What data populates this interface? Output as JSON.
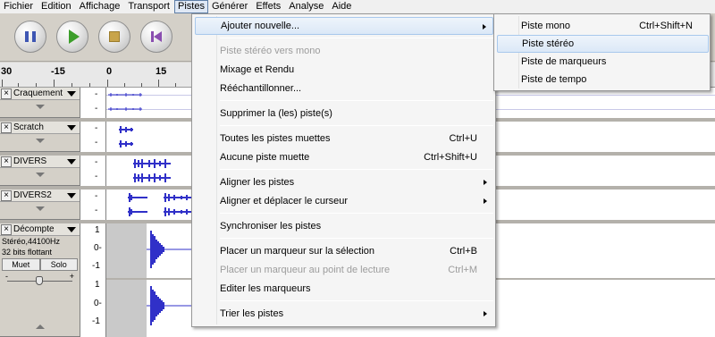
{
  "menubar": {
    "items": [
      "Fichier",
      "Edition",
      "Affichage",
      "Transport",
      "Pistes",
      "Générer",
      "Effets",
      "Analyse",
      "Aide"
    ],
    "active": "Pistes"
  },
  "transport": {
    "buttons": [
      {
        "name": "pause-button",
        "icon": "pause-icon"
      },
      {
        "name": "play-button",
        "icon": "play-icon"
      },
      {
        "name": "stop-button",
        "icon": "stop-icon"
      },
      {
        "name": "skip-start-button",
        "icon": "skip-start-icon"
      }
    ]
  },
  "ruler": {
    "labels": [
      "30",
      "-15",
      "0",
      "15"
    ]
  },
  "tracks": [
    {
      "name": "Craquement"
    },
    {
      "name": "Scratch"
    },
    {
      "name": "DIVERS"
    },
    {
      "name": "DIVERS2"
    },
    {
      "name": "Décompte",
      "info": [
        "Stéréo,44100Hz",
        "32 bits flottant"
      ],
      "mute": "Muet",
      "solo": "Solo",
      "gain_minus": "-",
      "gain_plus": "+",
      "scale_top": [
        "1",
        "0-",
        "-1"
      ],
      "scale_bottom": [
        "1",
        "0-",
        "-1"
      ]
    }
  ],
  "scale_small": [
    "-",
    "-"
  ],
  "pistes_menu": {
    "items": [
      {
        "label": "Ajouter nouvelle...",
        "shortcut": "",
        "submenu": true,
        "disabled": false,
        "hover": true
      },
      {
        "label": "Piste stéréo vers mono",
        "shortcut": "",
        "submenu": false,
        "disabled": true
      },
      {
        "label": "Mixage et Rendu",
        "shortcut": "",
        "submenu": false,
        "disabled": false
      },
      {
        "label": "Rééchantillonner...",
        "shortcut": "",
        "submenu": false,
        "disabled": false
      },
      {
        "label": "Supprimer la (les) piste(s)",
        "shortcut": "",
        "submenu": false,
        "disabled": false
      },
      {
        "label": "Toutes les pistes muettes",
        "shortcut": "Ctrl+U",
        "submenu": false,
        "disabled": false
      },
      {
        "label": "Aucune piste muette",
        "shortcut": "Ctrl+Shift+U",
        "submenu": false,
        "disabled": false
      },
      {
        "label": "Aligner les pistes",
        "shortcut": "",
        "submenu": true,
        "disabled": false
      },
      {
        "label": "Aligner et déplacer le curseur",
        "shortcut": "",
        "submenu": true,
        "disabled": false
      },
      {
        "label": "Synchroniser les pistes",
        "shortcut": "",
        "submenu": false,
        "disabled": false
      },
      {
        "label": "Placer un marqueur sur la sélection",
        "shortcut": "Ctrl+B",
        "submenu": false,
        "disabled": false
      },
      {
        "label": "Placer un marqueur au point de lecture",
        "shortcut": "Ctrl+M",
        "submenu": false,
        "disabled": true
      },
      {
        "label": "Editer les marqueurs",
        "shortcut": "",
        "submenu": false,
        "disabled": false
      },
      {
        "label": "Trier les pistes",
        "shortcut": "",
        "submenu": true,
        "disabled": false
      }
    ]
  },
  "ajouter_submenu": {
    "items": [
      {
        "label": "Piste mono",
        "shortcut": "Ctrl+Shift+N",
        "hover": false
      },
      {
        "label": "Piste stéréo",
        "shortcut": "",
        "hover": true
      },
      {
        "label": "Piste de marqueurs",
        "shortcut": "",
        "hover": false
      },
      {
        "label": "Piste de tempo",
        "shortcut": "",
        "hover": false
      }
    ]
  }
}
